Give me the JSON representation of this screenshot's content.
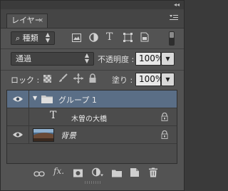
{
  "panel": {
    "tab_label": "レイヤー",
    "tab_close": "×"
  },
  "filter": {
    "kind_label": "種類",
    "search_glyph": "⌕",
    "type_glyph": "T"
  },
  "blend": {
    "mode_value": "通過",
    "opacity_label": "不透明度 :",
    "opacity_value": "100%"
  },
  "lock": {
    "lock_label": "ロック :",
    "fill_label": "塗り :",
    "fill_value": "100%"
  },
  "layers": [
    {
      "name": "グループ 1",
      "kind": "group",
      "visible": true,
      "locked": false
    },
    {
      "name": "木曽の大橋",
      "kind": "text",
      "visible": false,
      "locked": true
    },
    {
      "name": "背景",
      "kind": "image",
      "visible": true,
      "locked": true
    }
  ],
  "layer_glyphs": {
    "text_glyph": "T",
    "group_arrow": "▼"
  },
  "footer": {
    "fx_label": "fx."
  },
  "colors": {
    "panel_bg": "#535353",
    "selected_row": "#5a6e86",
    "field_bg": "#e8e8e8"
  }
}
